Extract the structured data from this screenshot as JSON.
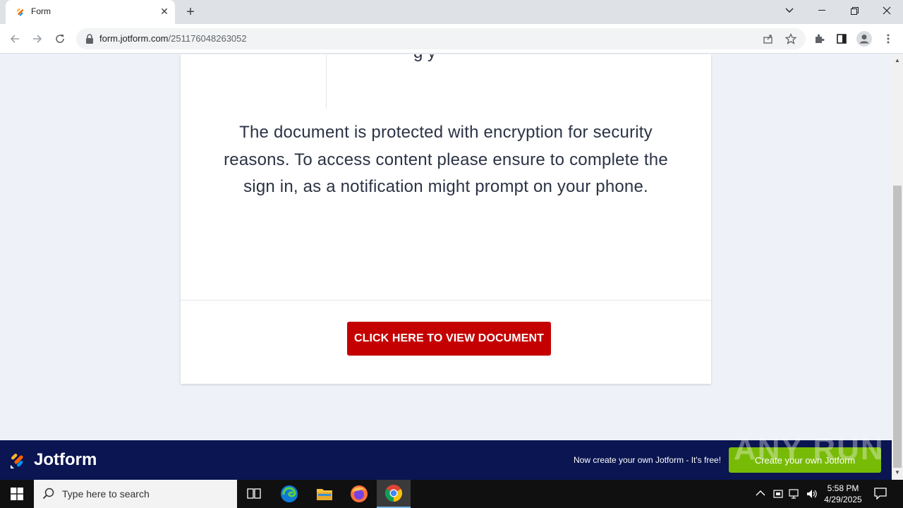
{
  "browser": {
    "tab_title": "Form",
    "tab_close": "✕",
    "new_tab": "+",
    "url_host": "form.jotform.com",
    "url_path": "/251176048263052"
  },
  "card": {
    "top_fragment": "g y",
    "message": "The document is protected with encryption for security reasons. To access content please ensure to complete the sign in, as a notification might prompt on your phone.",
    "button_label": "CLICK HERE TO VIEW DOCUMENT"
  },
  "footer": {
    "logo_text": "Jotform",
    "promo_text": "Now create your own Jotform - It's free!",
    "create_button": "Create your own Jotform",
    "watermark": "ANY RUN"
  },
  "taskbar": {
    "search_placeholder": "Type here to search",
    "time": "5:58 PM",
    "date": "4/29/2025"
  },
  "colors": {
    "view_button": "#c50000",
    "footer_bg": "#0a1551",
    "create_button": "#78bb07"
  }
}
